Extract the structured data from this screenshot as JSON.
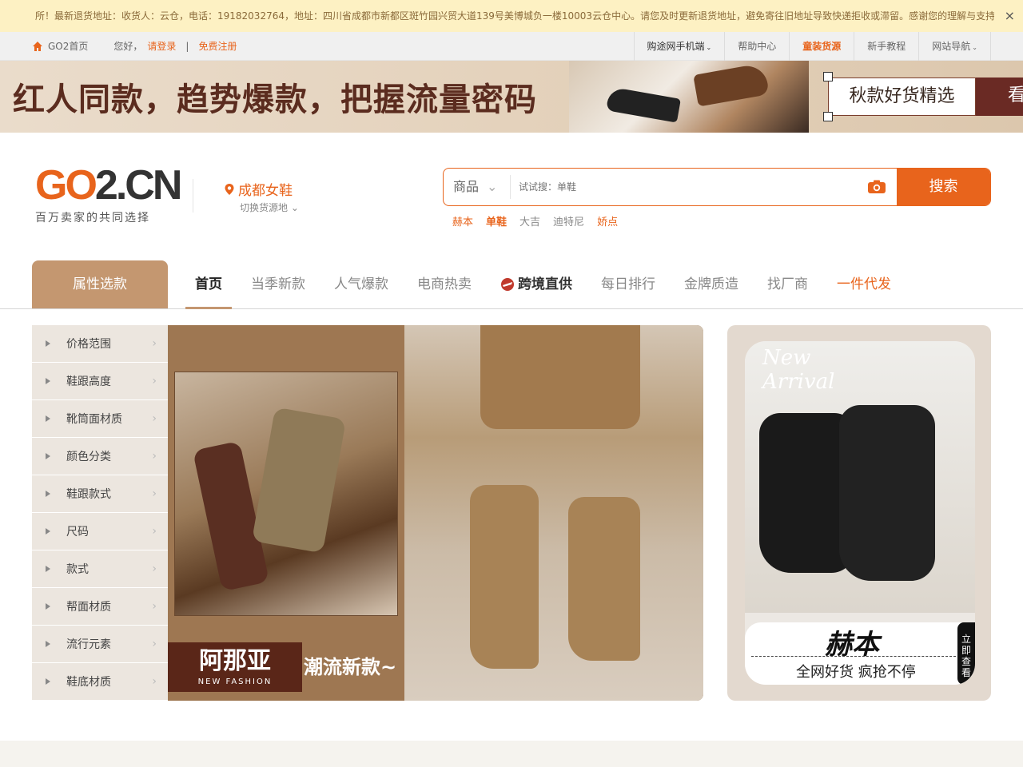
{
  "notice": {
    "text": "所！最新退货地址：收货人：云仓，电话：19182032764，地址：四川省成都市新都区斑竹园兴贸大道139号美博城负一楼10003云仓中心。请您及时更新退货地址，避免寄往旧地址导致快递拒收或滞留。感谢您的理解与支持，",
    "close": "×"
  },
  "topbar": {
    "home": "GO2首页",
    "greeting": "您好，",
    "login": "请登录",
    "separator": "|",
    "register": "免费注册",
    "right_items": [
      {
        "label": "购途网手机端",
        "caret": "⌄"
      },
      {
        "label": "帮助中心"
      },
      {
        "label": "童装货源"
      },
      {
        "label": "新手教程"
      },
      {
        "label": "网站导航",
        "caret": "⌄"
      }
    ]
  },
  "promo": {
    "slogan": "红人同款，趋势爆款，把握流量密码",
    "cta": "秋款好货精选",
    "cta2": "看"
  },
  "header": {
    "logo_go": "GO",
    "logo_rest": "2.CN",
    "logo_tagline": "百万卖家的共同选择",
    "city": "成都女鞋",
    "switch": "切换货源地"
  },
  "search": {
    "type": "商品",
    "placeholder": "试试搜：单鞋",
    "button": "搜索",
    "hotwords": [
      "赫本",
      "单鞋",
      "大吉",
      "迪特尼",
      "娇点"
    ]
  },
  "nav": {
    "category": "属性选款",
    "tabs": [
      "首页",
      "当季新款",
      "人气爆款",
      "电商热卖",
      "跨境直供",
      "每日排行",
      "金牌质造",
      "找厂商",
      "一件代发"
    ]
  },
  "sidebar": {
    "items": [
      "价格范围",
      "鞋跟高度",
      "靴筒面材质",
      "颜色分类",
      "鞋跟款式",
      "尺码",
      "款式",
      "帮面材质",
      "流行元素",
      "鞋底材质"
    ]
  },
  "banner": {
    "brand_cn": "阿那亚",
    "brand_en": "NEW FASHION",
    "slogan": "潮流新款~"
  },
  "side_ad": {
    "new_line1": "New",
    "new_line2": "Arrival",
    "brand": "赫本",
    "tagline": "全网好货 疯抢不停",
    "cta": "立即查看"
  }
}
